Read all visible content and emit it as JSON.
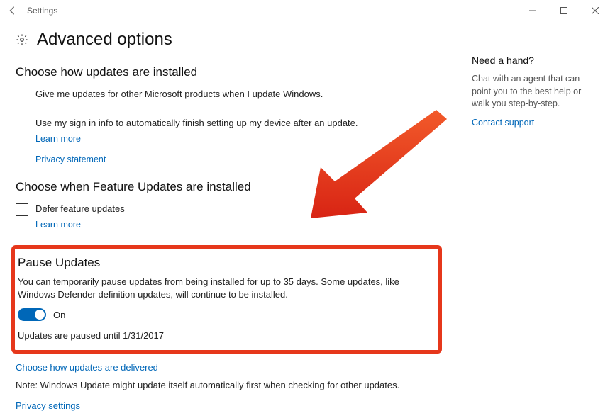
{
  "window": {
    "title": "Settings"
  },
  "page": {
    "title": "Advanced options"
  },
  "section1": {
    "heading": "Choose how updates are installed",
    "checkbox1Label": "Give me updates for other Microsoft products when I update Windows.",
    "checkbox2Label": "Use my sign in info to automatically finish setting up my device after an update.",
    "learnMore": "Learn more",
    "privacyStatement": "Privacy statement"
  },
  "section2": {
    "heading": "Choose when Feature Updates are installed",
    "checkbox1Label": "Defer feature updates",
    "learnMore": "Learn more"
  },
  "pause": {
    "heading": "Pause Updates",
    "description": "You can temporarily pause updates from being installed for up to 35 days. Some updates, like Windows Defender definition updates, will continue to be installed.",
    "toggleLabel": "On",
    "statusText": "Updates are paused until 1/31/2017"
  },
  "footer": {
    "deliveryLink": "Choose how updates are delivered",
    "note": "Note: Windows Update might update itself automatically first when checking for other updates.",
    "privacySettings": "Privacy settings"
  },
  "sidebar": {
    "heading": "Need a hand?",
    "body": "Chat with an agent that can point you to the best help or walk you step-by-step.",
    "contact": "Contact support"
  }
}
